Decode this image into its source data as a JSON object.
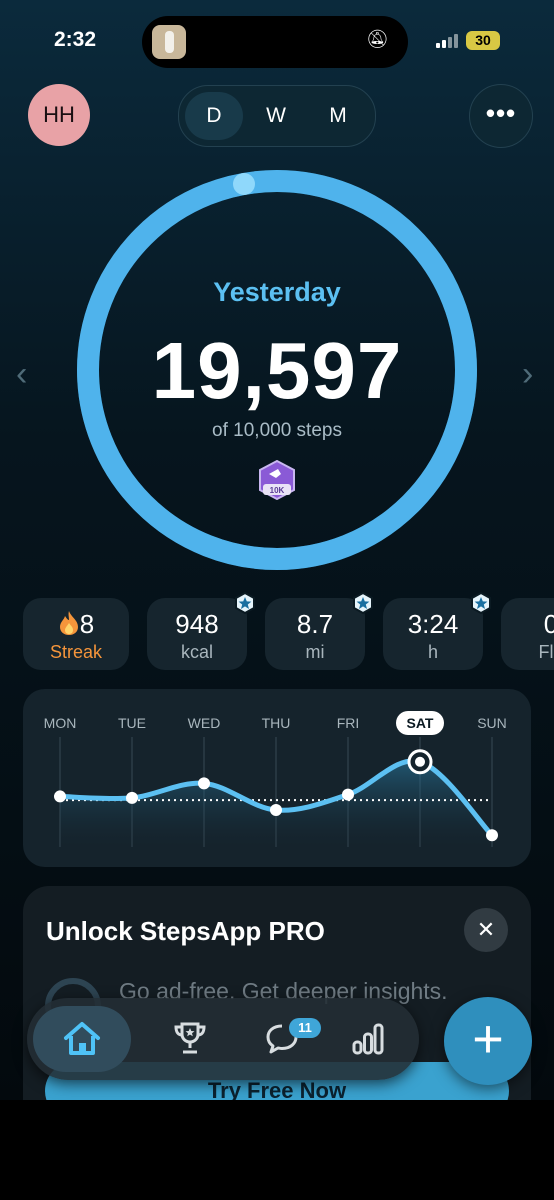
{
  "status": {
    "time": "2:32",
    "battery": "30"
  },
  "header": {
    "avatar_initials": "HH",
    "periods": [
      "D",
      "W",
      "M"
    ],
    "active_period": "D",
    "more_label": "•••"
  },
  "ring": {
    "label": "Yesterday",
    "value": "19,597",
    "goal_text": "of 10,000 steps",
    "progress": 1.0,
    "badge_text": "10K",
    "prev_label": "‹",
    "next_label": "›"
  },
  "stats": [
    {
      "value": "8",
      "label": "Streak",
      "icon": "flame-icon"
    },
    {
      "value": "948",
      "label": "kcal",
      "icon": "star-badge-icon"
    },
    {
      "value": "8.7",
      "label": "mi",
      "icon": "star-badge-icon"
    },
    {
      "value": "3:24",
      "label": "h",
      "icon": "star-badge-icon"
    },
    {
      "value": "0",
      "label": "Flo",
      "icon": ""
    }
  ],
  "chart_data": {
    "type": "line",
    "categories": [
      "MON",
      "TUE",
      "WED",
      "THU",
      "FRI",
      "SAT",
      "SUN"
    ],
    "values": [
      10800,
      10500,
      13600,
      7900,
      11200,
      18200,
      2500
    ],
    "highlight": "SAT",
    "goal_line": 10000,
    "ylim": [
      0,
      22000
    ],
    "grid": true
  },
  "promo": {
    "title": "Unlock StepsApp PRO",
    "close_label": "✕",
    "line1": "Go ad-free. Get deeper insights.",
    "line2": "",
    "button_label": "Try Free Now"
  },
  "tabbar": {
    "badge": "11",
    "fab_label": "+"
  },
  "colors": {
    "accent": "#5cc0f2",
    "ring": "#4fb3ec",
    "streak": "#f5953b"
  }
}
